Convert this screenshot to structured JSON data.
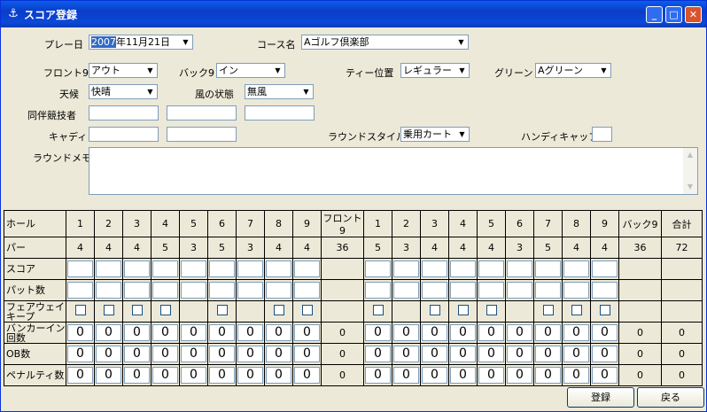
{
  "window": {
    "title": "スコア登録"
  },
  "form": {
    "play_date_label": "プレー日",
    "play_date_year_sel": "2007",
    "play_date_rest": "年11月21日",
    "course_label": "コース名",
    "course_value": "Aゴルフ倶楽部",
    "front9_label": "フロント9",
    "front9_value": "アウト",
    "back9_label": "バック9",
    "back9_value": "イン",
    "tee_label": "ティー位置",
    "tee_value": "レギュラー",
    "green_label": "グリーン",
    "green_value": "Aグリーン",
    "weather_label": "天候",
    "weather_value": "快晴",
    "wind_label": "風の状態",
    "wind_value": "無風",
    "companions_label": "同伴競技者",
    "caddy_label": "キャディ",
    "round_style_label": "ラウンドスタイル",
    "round_style_value": "乗用カート",
    "handicap_label": "ハンディキャップ",
    "memo_label": "ラウンドメモ"
  },
  "table": {
    "row_labels": [
      "ホール",
      "パー",
      "スコア",
      "パット数",
      "フェアウェイキープ",
      "バンカーイン回数",
      "OB数",
      "ペナルティ数"
    ],
    "front_holes": [
      "1",
      "2",
      "3",
      "4",
      "5",
      "6",
      "7",
      "8",
      "9"
    ],
    "front_total_label": "フロント9",
    "back_holes": [
      "1",
      "2",
      "3",
      "4",
      "5",
      "6",
      "7",
      "8",
      "9"
    ],
    "back_total_label": "バック9",
    "total_label": "合計",
    "front_par": [
      "4",
      "4",
      "4",
      "5",
      "3",
      "5",
      "3",
      "4",
      "4"
    ],
    "front_par_total": "36",
    "back_par": [
      "5",
      "3",
      "4",
      "4",
      "4",
      "3",
      "5",
      "4",
      "4"
    ],
    "back_par_total": "36",
    "par_total": "72",
    "front_fairway_checks": [
      true,
      true,
      true,
      true,
      false,
      true,
      false,
      true,
      true
    ],
    "back_fairway_checks": [
      true,
      false,
      true,
      true,
      true,
      false,
      true,
      true,
      true
    ],
    "zero": "0"
  },
  "buttons": {
    "register": "登録",
    "back": "戻る"
  }
}
